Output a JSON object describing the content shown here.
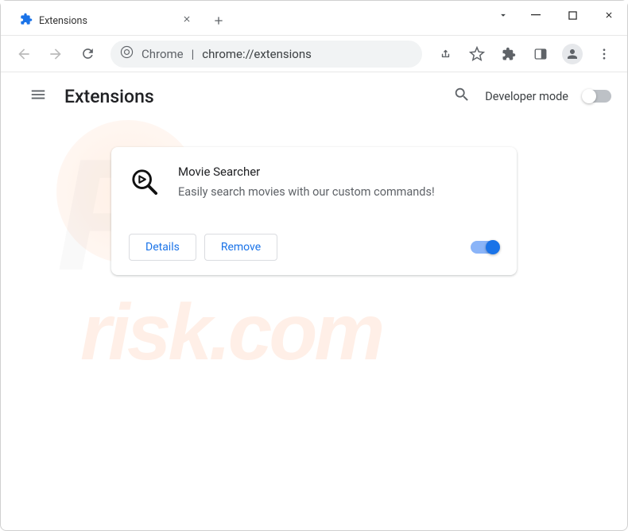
{
  "tab": {
    "title": "Extensions"
  },
  "omnibox": {
    "scheme": "Chrome",
    "path": "chrome://extensions"
  },
  "header": {
    "title": "Extensions",
    "dev_mode_label": "Developer mode"
  },
  "extension": {
    "name": "Movie Searcher",
    "description": "Easily search movies with our custom commands!",
    "details_label": "Details",
    "remove_label": "Remove",
    "enabled": true
  },
  "watermark": {
    "big": "PC",
    "sub": "risk.com"
  }
}
